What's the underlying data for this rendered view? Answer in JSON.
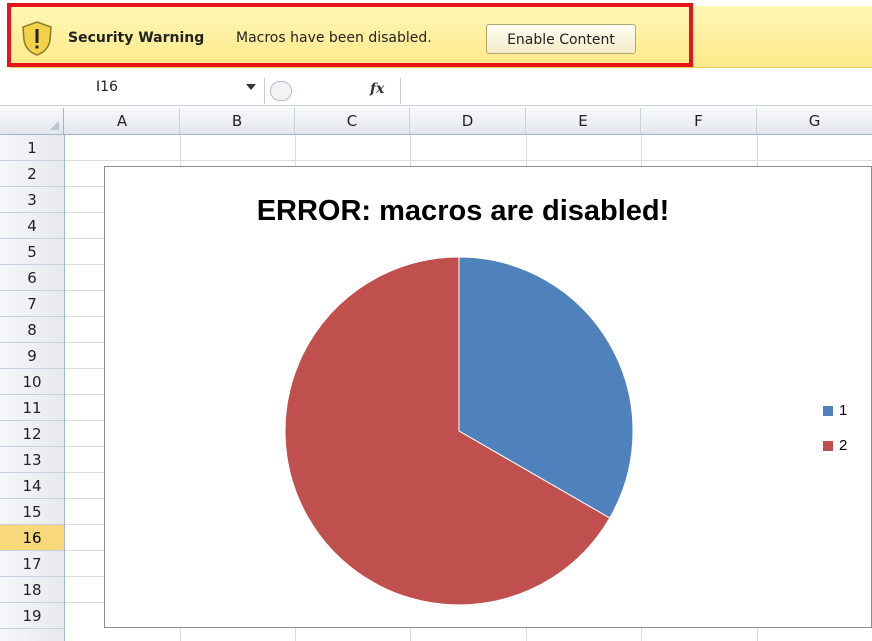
{
  "security_bar": {
    "title": "Security Warning",
    "message": "Macros have been disabled.",
    "button_label": "Enable Content"
  },
  "formula_bar": {
    "name_box": "I16",
    "fx_label": "fx"
  },
  "columns": [
    "A",
    "B",
    "C",
    "D",
    "E",
    "F",
    "G"
  ],
  "rows": [
    "1",
    "2",
    "3",
    "4",
    "5",
    "6",
    "7",
    "8",
    "9",
    "10",
    "11",
    "12",
    "13",
    "14",
    "15",
    "16",
    "17",
    "18",
    "19"
  ],
  "active_row": "16",
  "colors": {
    "series_1": "#4f81bd",
    "series_2": "#c0504d",
    "highlight_border": "#e8141c"
  },
  "chart_data": {
    "type": "pie",
    "title": "ERROR: macros are disabled!",
    "categories": [
      "1",
      "2"
    ],
    "values": [
      1,
      2
    ],
    "legend_placement": "right"
  }
}
